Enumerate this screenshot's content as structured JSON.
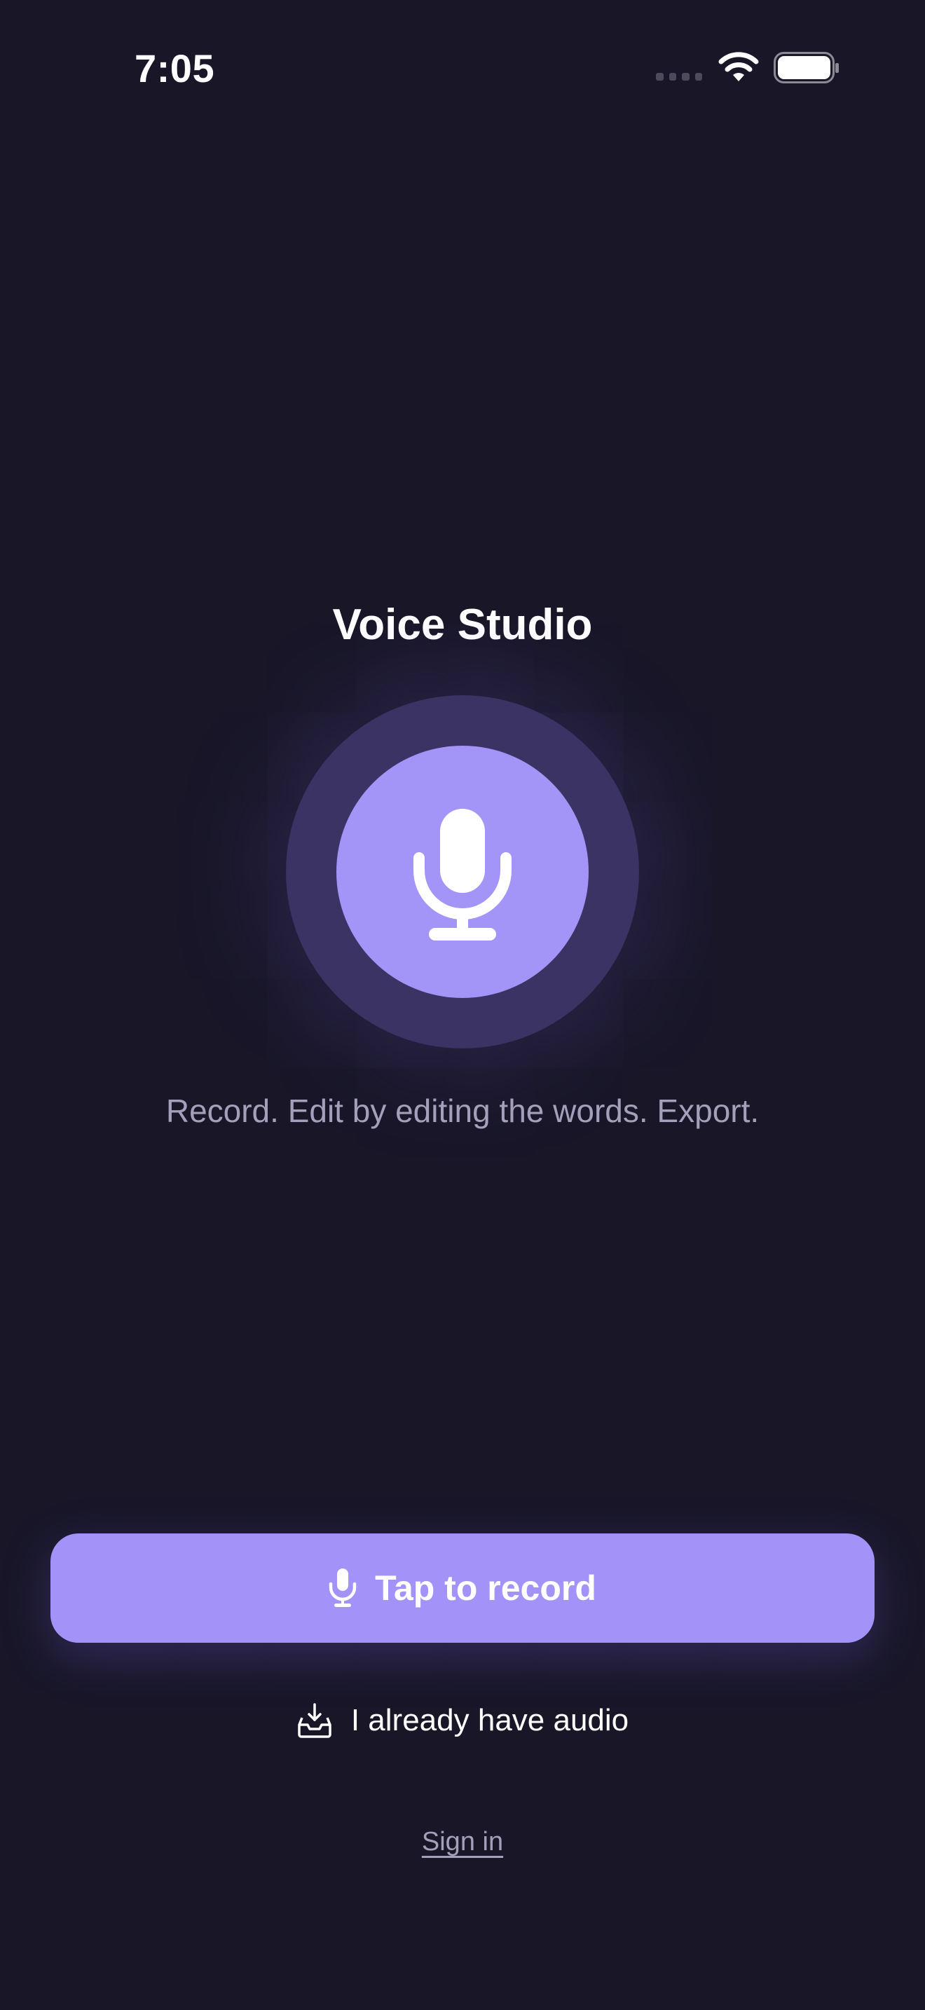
{
  "status_bar": {
    "time": "7:05",
    "icons": [
      "signal-dots-icon",
      "wifi-icon",
      "battery-icon"
    ]
  },
  "hero": {
    "title": "Voice Studio",
    "mic_icon": "microphone-icon",
    "tagline": "Record. Edit by editing the words. Export."
  },
  "actions": {
    "record_label": "Tap to record",
    "record_icon": "microphone-icon",
    "have_audio_label": "I already have audio",
    "have_audio_icon": "inbox-download-icon",
    "sign_in_label": "Sign in"
  },
  "colors": {
    "background": "#181627",
    "accent": "#a393f9",
    "ring": "#3a3363",
    "muted_text": "#a49fbb"
  }
}
